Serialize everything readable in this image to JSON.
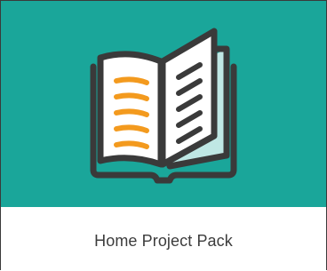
{
  "card": {
    "title": "Home Project Pack",
    "icon": "open-book-icon",
    "colors": {
      "header_background": "#1aa69a",
      "icon_outline": "#3a3a3a",
      "left_page_lines": "#f39a1e",
      "right_page_lines": "#3a3a3a",
      "page_fill": "#ffffff",
      "page_shadow": "#bfe7e4"
    }
  }
}
